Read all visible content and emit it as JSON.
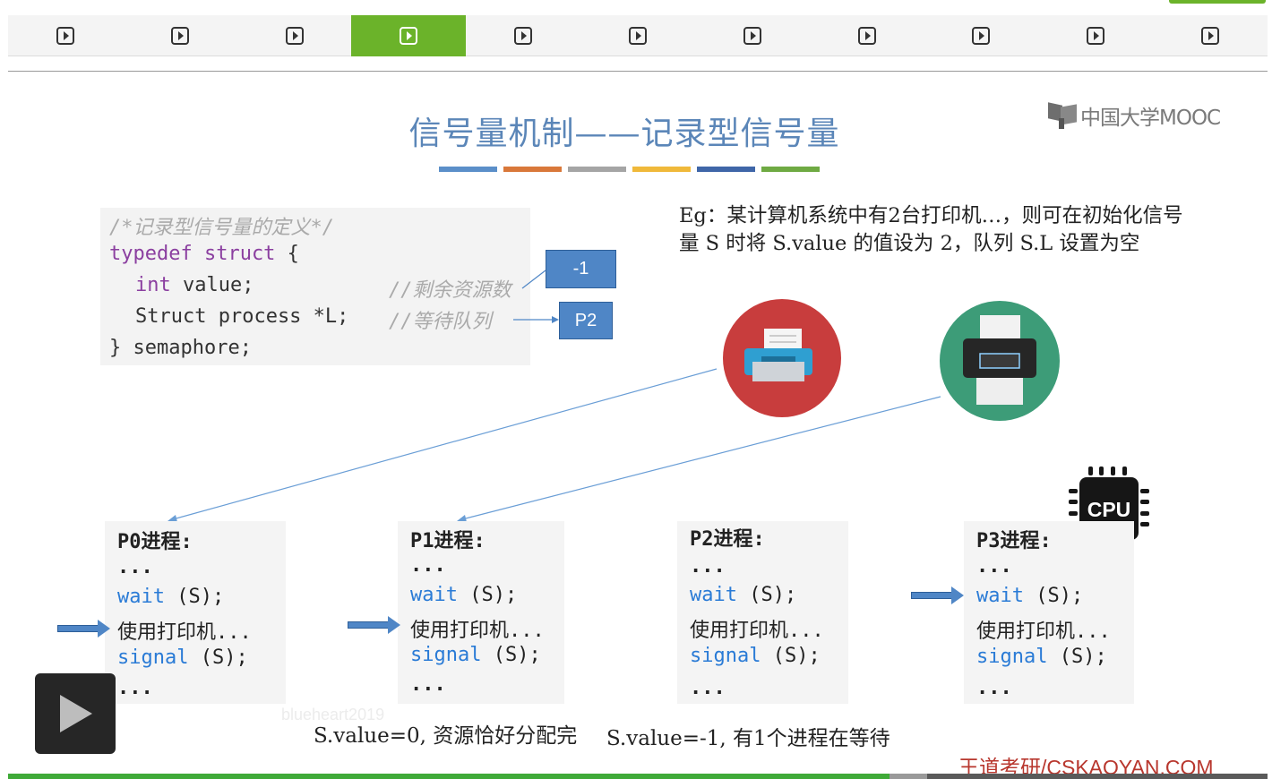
{
  "tabs": {
    "count": 11,
    "active_index": 3,
    "items": [
      {
        "icon": "play-square-icon"
      },
      {
        "icon": "play-square-icon"
      },
      {
        "icon": "play-square-icon"
      },
      {
        "icon": "play-square-icon"
      },
      {
        "icon": "play-square-icon"
      },
      {
        "icon": "play-square-icon"
      },
      {
        "icon": "play-square-icon"
      },
      {
        "icon": "play-square-icon"
      },
      {
        "icon": "play-square-icon"
      },
      {
        "icon": "play-square-icon"
      },
      {
        "icon": "play-square-icon"
      }
    ]
  },
  "slide": {
    "title": "信号量机制——记录型信号量",
    "title_bar_colors": [
      "#5b8fc9",
      "#d9783a",
      "#a5a5a5",
      "#f0b93a",
      "#3f66a8",
      "#6faa43"
    ],
    "logo_text": "中国大学MOOC",
    "code": {
      "line1": "/*记录型信号量的定义*/",
      "line2_kw": "typedef struct",
      "line2_rest": " {",
      "line3_type": "int",
      "line3_rest": " value;",
      "line3_comment": "//剩余资源数",
      "line4_code": "Struct process *L;",
      "line4_comment": "//等待队列",
      "line5": "} semaphore;"
    },
    "value_box": "-1",
    "queue_box": "P2",
    "example": "Eg：某计算机系统中有2台打印机…，则可在初始化信号量 S 时将 S.value 的值设为 2，队列 S.L 设置为空",
    "cpu_label": "CPU",
    "processes": [
      {
        "name": "P0进程:",
        "dots1": "...",
        "wait_fn": "wait",
        "wait_arg": " (S);",
        "use": "使用打印机...",
        "signal_fn": "signal",
        "signal_arg": " (S);",
        "dots2": "..."
      },
      {
        "name": "P1进程:",
        "dots1": "...",
        "wait_fn": "wait",
        "wait_arg": " (S);",
        "use": "使用打印机...",
        "signal_fn": "signal",
        "signal_arg": " (S);",
        "dots2": "..."
      },
      {
        "name": "P2进程:",
        "dots1": "...",
        "wait_fn": "wait",
        "wait_arg": " (S);",
        "use": "使用打印机...",
        "signal_fn": "signal",
        "signal_arg": " (S);",
        "dots2": "..."
      },
      {
        "name": "P3进程:",
        "dots1": "...",
        "wait_fn": "wait",
        "wait_arg": " (S);",
        "use": "使用打印机...",
        "signal_fn": "signal",
        "signal_arg": " (S);",
        "dots2": "..."
      }
    ],
    "caption_left": "S.value=0, 资源恰好分配完",
    "caption_right": "S.value=-1, 有1个进程在等待",
    "watermark": "blueheart2019",
    "site": "王道考研/CSKAOYAN.COM"
  },
  "player": {
    "play_icon": "play-icon",
    "progress_fraction": 0.7,
    "buffered_fraction": 0.73,
    "colors": {
      "accent": "#6bb32a",
      "progress": "#3faa38",
      "title": "#5b86b8",
      "box": "#4f86c6",
      "site": "#b8372e"
    }
  }
}
